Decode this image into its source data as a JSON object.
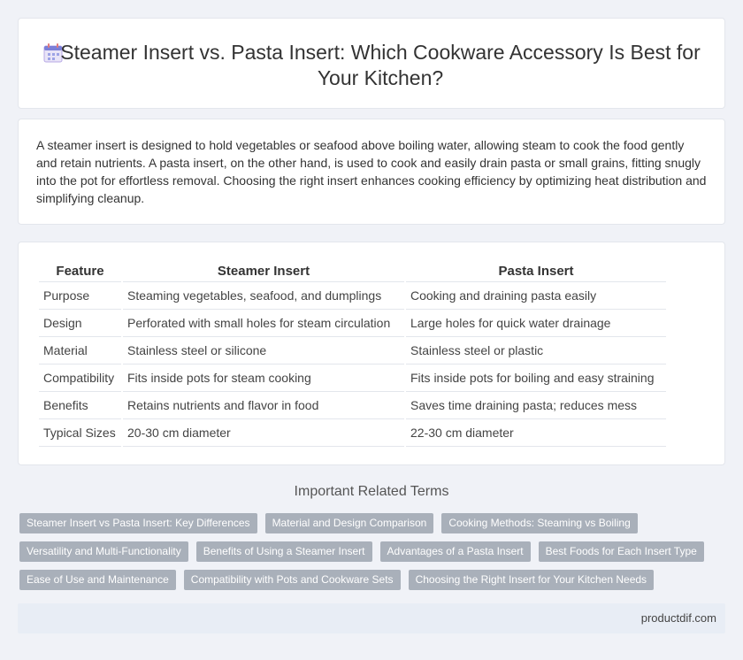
{
  "header": {
    "title": "Steamer Insert vs. Pasta Insert: Which Cookware Accessory Is Best for Your Kitchen?",
    "icon": "calendar-icon"
  },
  "intro": "A steamer insert is designed to hold vegetables or seafood above boiling water, allowing steam to cook the food gently and retain nutrients. A pasta insert, on the other hand, is used to cook and easily drain pasta or small grains, fitting snugly into the pot for effortless removal. Choosing the right insert enhances cooking efficiency by optimizing heat distribution and simplifying cleanup.",
  "table": {
    "headers": [
      "Feature",
      "Steamer Insert",
      "Pasta Insert"
    ],
    "rows": [
      [
        "Purpose",
        "Steaming vegetables, seafood, and dumplings",
        "Cooking and draining pasta easily"
      ],
      [
        "Design",
        "Perforated with small holes for steam circulation",
        "Large holes for quick water drainage"
      ],
      [
        "Material",
        "Stainless steel or silicone",
        "Stainless steel or plastic"
      ],
      [
        "Compatibility",
        "Fits inside pots for steam cooking",
        "Fits inside pots for boiling and easy straining"
      ],
      [
        "Benefits",
        "Retains nutrients and flavor in food",
        "Saves time draining pasta; reduces mess"
      ],
      [
        "Typical Sizes",
        "20-30 cm diameter",
        "22-30 cm diameter"
      ]
    ]
  },
  "related": {
    "title": "Important Related Terms",
    "tags": [
      [
        "Steamer Insert vs Pasta Insert: Key Differences",
        "Material and Design Comparison",
        "Cooking Methods: Steaming vs Boiling"
      ],
      [
        "Versatility and Multi-Functionality",
        "Benefits of Using a Steamer Insert",
        "Advantages of a Pasta Insert",
        "Best Foods for Each Insert Type"
      ],
      [
        "Ease of Use and Maintenance",
        "Compatibility with Pots and Cookware Sets",
        "Choosing the Right Insert for Your Kitchen Needs"
      ]
    ]
  },
  "footer": {
    "site": "productdif.com"
  },
  "colors": {
    "tag_bg": "#a9b0ba",
    "page_bg": "#f0f2f7",
    "footer_bg": "#e8edf5"
  }
}
